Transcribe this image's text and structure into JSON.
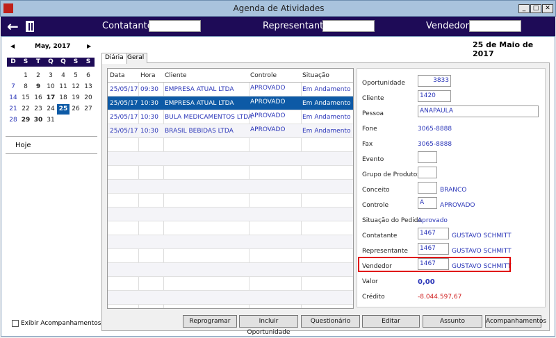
{
  "window": {
    "title": "Agenda de Atividades",
    "controls": [
      "_",
      "□",
      "✕"
    ]
  },
  "header": {
    "contatante_label": "Contatante",
    "representante_label": "Representante",
    "vendedor_label": "Vendedor",
    "contatante_value": "",
    "representante_value": "",
    "vendedor_value": ""
  },
  "calendar": {
    "month": "May, 2017",
    "weekdays": [
      "D",
      "S",
      "T",
      "Q",
      "Q",
      "S",
      "S"
    ],
    "weeks": [
      [
        "",
        "1",
        "2",
        "3",
        "4",
        "5",
        "6"
      ],
      [
        "7",
        "8",
        "9",
        "10",
        "11",
        "12",
        "13"
      ],
      [
        "14",
        "15",
        "16",
        "17",
        "18",
        "19",
        "20"
      ],
      [
        "21",
        "22",
        "23",
        "24",
        "25",
        "26",
        "27"
      ],
      [
        "28",
        "29",
        "30",
        "31",
        "",
        "",
        ""
      ]
    ],
    "bold_days": [
      "9",
      "17",
      "29",
      "30"
    ],
    "selected_day": "25",
    "today_label": "Hoje",
    "show_followups_label": "Exibir Acompanhamentos",
    "show_followups_checked": false
  },
  "date_title": "25 de Maio de 2017",
  "tabs": [
    {
      "label": "Diária",
      "active": true
    },
    {
      "label": "Geral",
      "active": false
    }
  ],
  "grid": {
    "columns": [
      "Data",
      "Hora",
      "Cliente",
      "Controle",
      "Situação"
    ],
    "rows": [
      [
        "25/05/17",
        "09:30",
        "EMPRESA ATUAL LTDA",
        "APROVADO",
        "Em Andamento"
      ],
      [
        "25/05/17",
        "10:30",
        "EMPRESA ATUAL LTDA",
        "APROVADO",
        "Em Andamento"
      ],
      [
        "25/05/17",
        "10:30",
        "BULA MEDICAMENTOS LTDA",
        "APROVADO",
        "Em Andamento"
      ],
      [
        "25/05/17",
        "10:30",
        "BRASIL BEBIDAS LTDA",
        "APROVADO",
        "Em Andamento"
      ]
    ],
    "selected_row": 1
  },
  "detail": {
    "oportunidade": {
      "label": "Oportunidade",
      "value": "3833"
    },
    "cliente": {
      "label": "Cliente",
      "value": "1420"
    },
    "pessoa": {
      "label": "Pessoa",
      "value": "ANAPAULA"
    },
    "fone": {
      "label": "Fone",
      "value": "3065-8888"
    },
    "fax": {
      "label": "Fax",
      "value": "3065-8888"
    },
    "evento": {
      "label": "Evento",
      "value": ""
    },
    "grupo": {
      "label": "Grupo de Produtos",
      "value": ""
    },
    "conceito": {
      "label": "Conceito",
      "value": "",
      "desc": "BRANCO"
    },
    "controle": {
      "label": "Controle",
      "value": "A",
      "desc": "APROVADO"
    },
    "situacao": {
      "label": "Situação do Pedido",
      "value": "Aprovado"
    },
    "contatante": {
      "label": "Contatante",
      "value": "1467",
      "desc": "GUSTAVO SCHMITT"
    },
    "representante": {
      "label": "Representante",
      "value": "1467",
      "desc": "GUSTAVO SCHMITT"
    },
    "vendedor": {
      "label": "Vendedor",
      "value": "1467",
      "desc": "GUSTAVO SCHMITT"
    },
    "valor": {
      "label": "Valor",
      "value": "0,00"
    },
    "credito": {
      "label": "Crédito",
      "value": "-8.044.597,67"
    }
  },
  "buttons": [
    "Reprogramar",
    "Incluir Oportunidade",
    "Questionário",
    "Editar",
    "Assunto",
    "Acompanhamentos"
  ],
  "colors": {
    "header": "#1e0b57",
    "selection": "#0d5aa6",
    "highlight": "#e00000",
    "link_text": "#2a35b8",
    "negative": "#d02020"
  }
}
